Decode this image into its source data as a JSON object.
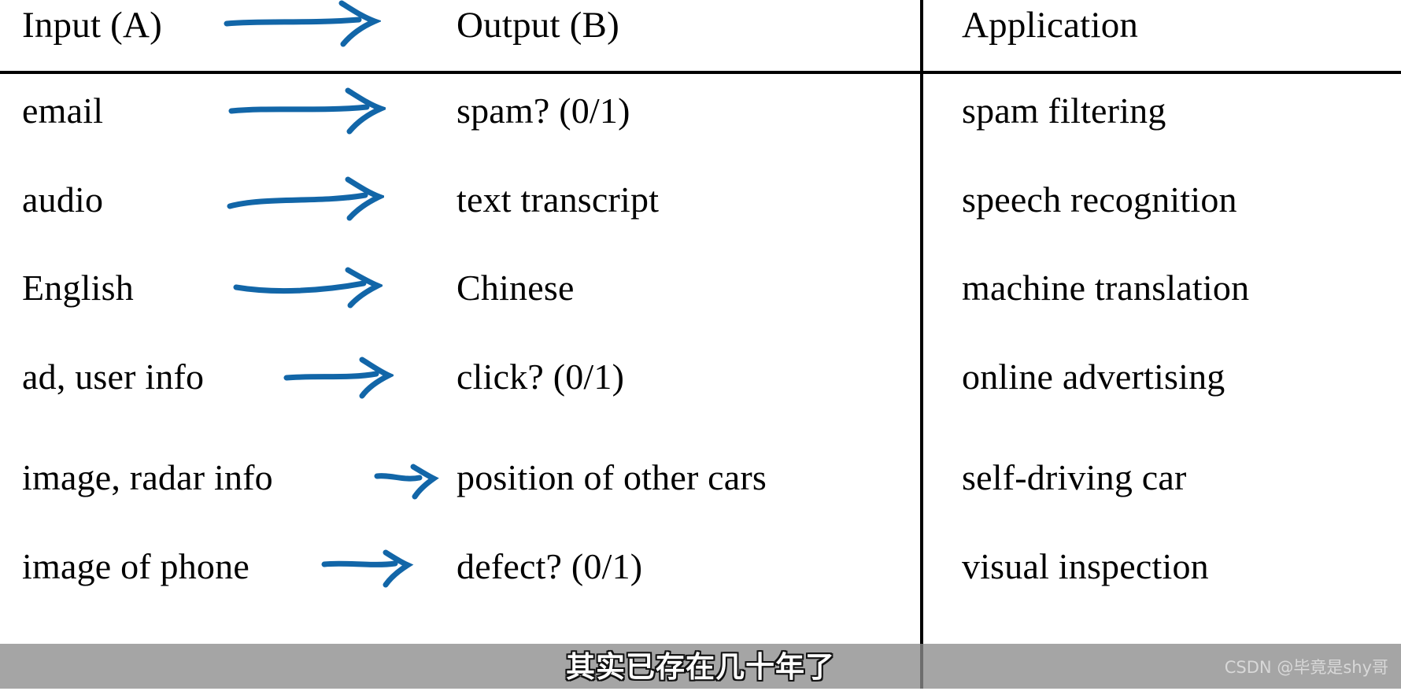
{
  "page": {
    "background_color": "#ffffff",
    "text_color": "#000000",
    "arrow_color": "#1266a8",
    "rule_color": "#000000"
  },
  "table": {
    "headers": {
      "input": "Input (A)",
      "output": "Output (B)",
      "application": "Application"
    },
    "rows": [
      {
        "input": "email",
        "output": "spam? (0/1)",
        "application": "spam filtering"
      },
      {
        "input": "audio",
        "output": "text transcript",
        "application": "speech recognition"
      },
      {
        "input": "English",
        "output": "Chinese",
        "application": "machine translation"
      },
      {
        "input": "ad, user info",
        "output": "click? (0/1)",
        "application": "online advertising"
      },
      {
        "input": "image, radar info",
        "output": "position of other cars",
        "application": "self-driving car"
      },
      {
        "input": "image of phone",
        "output": "defect? (0/1)",
        "application": "visual inspection"
      }
    ]
  },
  "overlay": {
    "subtitle": "其实已存在几十年了",
    "watermark": "CSDN @毕竟是shy哥",
    "bar_color": "#8c8c8c",
    "subtitle_color": "#ffffff",
    "watermark_color": "#d8d8d8"
  }
}
